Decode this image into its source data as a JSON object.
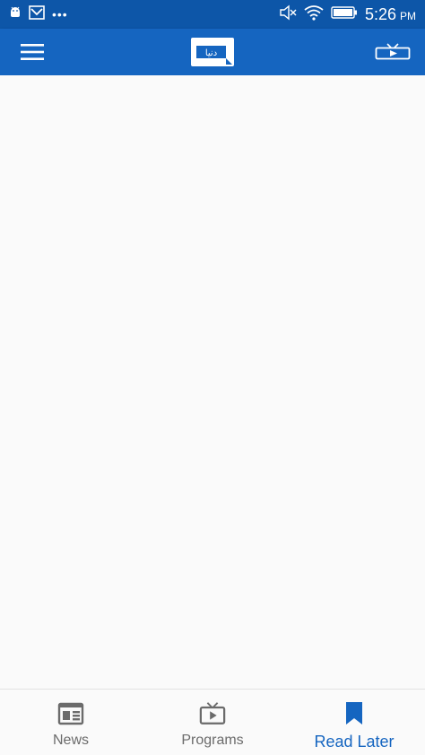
{
  "status_bar": {
    "time": "5:26",
    "ampm": "PM",
    "left_icons": [
      "android-icon",
      "gmail-icon",
      "more-dots-icon"
    ],
    "right_icons": [
      "mute-icon",
      "wifi-icon",
      "battery-icon"
    ]
  },
  "app_bar": {
    "logo_text": "دنیا",
    "icons": [
      "menu-icon",
      "logo-icon",
      "live-tv-icon"
    ]
  },
  "bottom_nav": {
    "items": [
      {
        "label": "News",
        "icon": "news-icon",
        "active": false
      },
      {
        "label": "Programs",
        "icon": "tv-icon",
        "active": false
      },
      {
        "label": "Read Later",
        "icon": "bookmark-icon",
        "active": true
      }
    ]
  },
  "colors": {
    "status_bar": "#0d56a8",
    "app_bar": "#1565c0",
    "accent": "#1565c0",
    "inactive": "#6b6b6b",
    "background": "#fafafa"
  }
}
